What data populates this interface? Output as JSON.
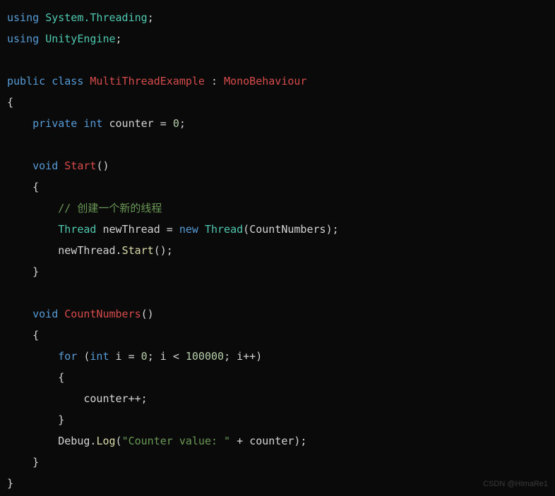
{
  "code": {
    "using1_kw": "using",
    "using1_ns": "System.Threading",
    "using2_kw": "using",
    "using2_ns": "UnityEngine",
    "public_kw": "public",
    "class_kw": "class",
    "class_name": "MultiThreadExample",
    "colon": ":",
    "base_class": "MonoBehaviour",
    "private_kw": "private",
    "int_kw": "int",
    "counter_var": "counter",
    "equals": "=",
    "zero": "0",
    "void_kw": "void",
    "start_method": "Start",
    "comment_text": "// 创建一个新的线程",
    "thread_type": "Thread",
    "newthread_var": "newThread",
    "new_kw": "new",
    "thread_ctor": "Thread",
    "countnumbers_arg": "CountNumbers",
    "start_call": "Start",
    "countnumbers_method": "CountNumbers",
    "for_kw": "for",
    "int_kw2": "int",
    "i_var": "i",
    "zero2": "0",
    "lt": "<",
    "limit": "100000",
    "increment": "i++",
    "counter_inc": "counter++",
    "debug_obj": "Debug",
    "log_call": "Log",
    "log_string": "\"Counter value: \"",
    "plus": "+",
    "counter_ref": "counter"
  },
  "watermark": "CSDN @HImaRe1"
}
